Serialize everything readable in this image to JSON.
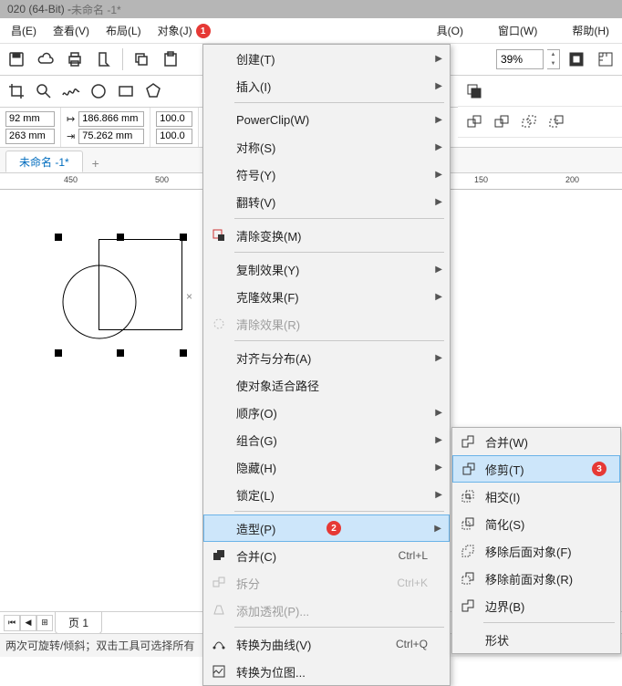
{
  "title_prefix": "020 (64-Bit) - ",
  "title_doc": "未命名 -1*",
  "menubar": {
    "file": "昌(E)",
    "view": "查看(V)",
    "layout": "布局(L)",
    "object": "对象(J)",
    "tool": "具(O)",
    "window": "窗口(W)",
    "help": "帮助(H)"
  },
  "toolbar": {
    "zoom_value": "39%"
  },
  "props": {
    "x": "92 mm",
    "y": "263 mm",
    "w": "186.866 mm",
    "h": "75.262 mm",
    "sx": "100.0",
    "sy": "100.0"
  },
  "tab": "未命名 -1*",
  "ruler": {
    "t0": "450",
    "t1": "500",
    "t2": "150",
    "t3": "200"
  },
  "page_tab": "页 1",
  "status": "两次可旋转/倾斜；双击工具可选择所有",
  "badges": {
    "b1": "1",
    "b2": "2",
    "b3": "3"
  },
  "dd1": {
    "create": "创建(T)",
    "insert": "插入(I)",
    "powerclip": "PowerClip(W)",
    "symmetry": "对称(S)",
    "symbol": "符号(Y)",
    "flip": "翻转(V)",
    "clear_trans": "清除变换(M)",
    "copy_effect": "复制效果(Y)",
    "clone_effect": "克隆效果(F)",
    "clear_effect": "清除效果(R)",
    "align": "对齐与分布(A)",
    "fit_path": "使对象适合路径",
    "order": "顺序(O)",
    "group": "组合(G)",
    "hide": "隐藏(H)",
    "lock": "锁定(L)",
    "shaping": "造型(P)",
    "combine": "合并(C)",
    "break": "拆分",
    "perspective": "添加透视(P)...",
    "to_curve": "转换为曲线(V)",
    "to_bitmap": "转换为位图...",
    "sc_combine": "Ctrl+L",
    "sc_break": "Ctrl+K",
    "sc_curve": "Ctrl+Q"
  },
  "dd2": {
    "weld": "合并(W)",
    "trim": "修剪(T)",
    "intersect": "相交(I)",
    "simplify": "简化(S)",
    "front_minus": "移除后面对象(F)",
    "back_minus": "移除前面对象(R)",
    "boundary": "边界(B)",
    "shape": "形状"
  }
}
